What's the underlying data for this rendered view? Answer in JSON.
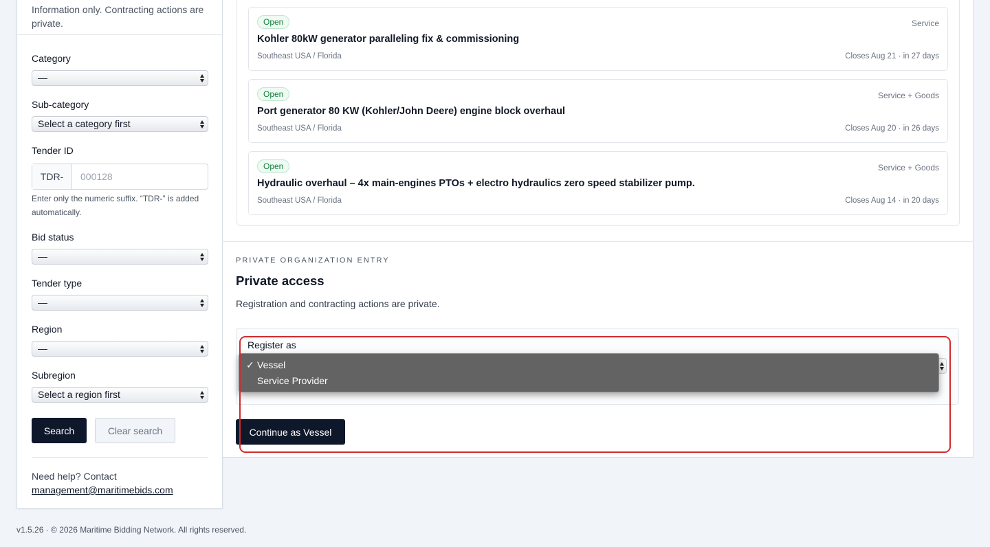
{
  "sidebar": {
    "info_text": "Information only. Contracting actions are private.",
    "category": {
      "label": "Category",
      "value": "—"
    },
    "subcategory": {
      "label": "Sub-category",
      "value": "Select a category first"
    },
    "tender_id": {
      "label": "Tender ID",
      "prefix": "TDR-",
      "placeholder": "000128",
      "hint": "Enter only the numeric suffix. “TDR-” is added automatically."
    },
    "bid_status": {
      "label": "Bid status",
      "value": "—"
    },
    "tender_type": {
      "label": "Tender type",
      "value": "—"
    },
    "region": {
      "label": "Region",
      "value": "—"
    },
    "subregion": {
      "label": "Subregion",
      "value": "Select a region first"
    },
    "search_label": "Search",
    "clear_label": "Clear search",
    "help_text": "Need help? Contact",
    "help_email": "management@maritimebids.com"
  },
  "tenders": [
    {
      "status": "Open",
      "type": "Service",
      "title": "Kohler 80kW generator paralleling fix & commissioning",
      "region": "Southeast USA / Florida",
      "closes": "Closes Aug 21 · in 27 days"
    },
    {
      "status": "Open",
      "type": "Service + Goods",
      "title": "Port generator 80 KW (Kohler/John Deere) engine block overhaul",
      "region": "Southeast USA / Florida",
      "closes": "Closes Aug 20 · in 26 days"
    },
    {
      "status": "Open",
      "type": "Service + Goods",
      "title": "Hydraulic overhaul – 4x main-engines PTOs + electro hydraulics zero speed stabilizer pump.",
      "region": "Southeast USA / Florida",
      "closes": "Closes Aug 14 · in 20 days"
    }
  ],
  "private_access": {
    "eyebrow": "PRIVATE ORGANIZATION ENTRY",
    "title": "Private access",
    "description": "Registration and contracting actions are private.",
    "register_label": "Register as",
    "options": [
      {
        "label": "Vessel",
        "check": "✓"
      },
      {
        "label": "Service Provider",
        "check": ""
      }
    ],
    "continue_label": "Continue as Vessel"
  },
  "colors": {
    "primary": "#0f172a",
    "badge_green": "#15803d",
    "highlight_red": "#d12b2b"
  },
  "footer": "v1.5.26 · © 2026 Maritime Bidding Network. All rights reserved."
}
